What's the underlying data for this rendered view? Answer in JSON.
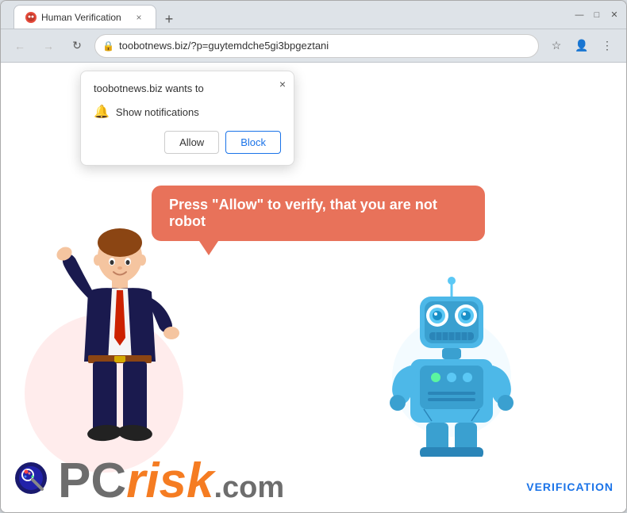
{
  "window": {
    "title": "Human Verification",
    "favicon_color": "#e74c3c"
  },
  "tab": {
    "label": "Human Verification",
    "close_label": "×"
  },
  "new_tab_btn": "+",
  "window_controls": {
    "minimize": "—",
    "maximize": "□",
    "close": "✕"
  },
  "nav": {
    "back_btn": "←",
    "forward_btn": "→",
    "reload_btn": "↻",
    "url": "toobotnews.biz/?p=guytemdche5gi3bpgeztani",
    "url_display": "toobotnews.biz/?p=guytemdche5gi3bpgeztani",
    "bookmark_icon": "☆",
    "account_icon": "👤",
    "menu_icon": "⋮"
  },
  "notification_popup": {
    "title": "toobotnews.biz wants to",
    "close_btn": "×",
    "item_label": "Show notifications",
    "allow_btn": "Allow",
    "block_btn": "Block"
  },
  "speech_bubble": {
    "text": "Press \"Allow\" to verify, that you are not robot"
  },
  "bottom_logo": {
    "pc_text": "PC",
    "risk_text": "risk",
    "com_text": ".com"
  },
  "verification_label": "VERIFICATION"
}
